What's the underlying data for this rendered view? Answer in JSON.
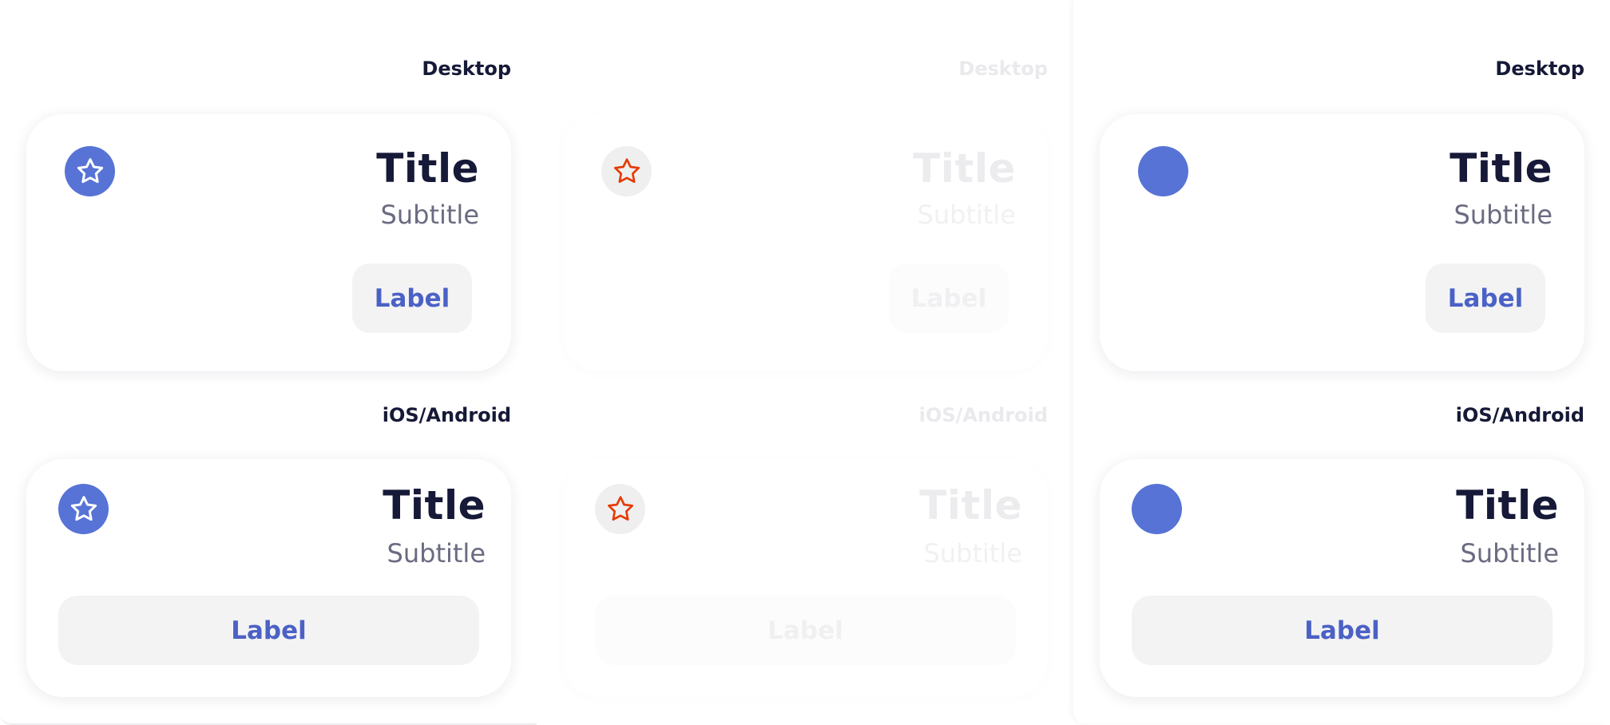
{
  "colors": {
    "accent": "#5773d6",
    "button_text": "#4b61c5",
    "title": "#161937",
    "subtitle": "#6a6b81",
    "button_bg": "#f3f3f4",
    "star_outline_variant": "#e63a00"
  },
  "panels": [
    {
      "state": "default",
      "desktop_label": "Desktop",
      "mobile_label": "iOS/Android",
      "desktop_card": {
        "icon": "star-icon",
        "title": "Title",
        "subtitle": "Subtitle",
        "button_label": "Label"
      },
      "mobile_card": {
        "icon": "star-icon",
        "title": "Title",
        "subtitle": "Subtitle",
        "button_label": "Label"
      }
    },
    {
      "state": "faded",
      "desktop_label": "Desktop",
      "mobile_label": "iOS/Android",
      "desktop_card": {
        "icon": "star-icon",
        "title": "Title",
        "subtitle": "Subtitle",
        "button_label": "Label"
      },
      "mobile_card": {
        "icon": "star-icon",
        "title": "Title",
        "subtitle": "Subtitle",
        "button_label": "Label"
      }
    },
    {
      "state": "no-icon-glyph",
      "desktop_label": "Desktop",
      "mobile_label": "iOS/Android",
      "desktop_card": {
        "icon": "circle-avatar",
        "title": "Title",
        "subtitle": "Subtitle",
        "button_label": "Label"
      },
      "mobile_card": {
        "icon": "circle-avatar",
        "title": "Title",
        "subtitle": "Subtitle",
        "button_label": "Label"
      }
    }
  ]
}
